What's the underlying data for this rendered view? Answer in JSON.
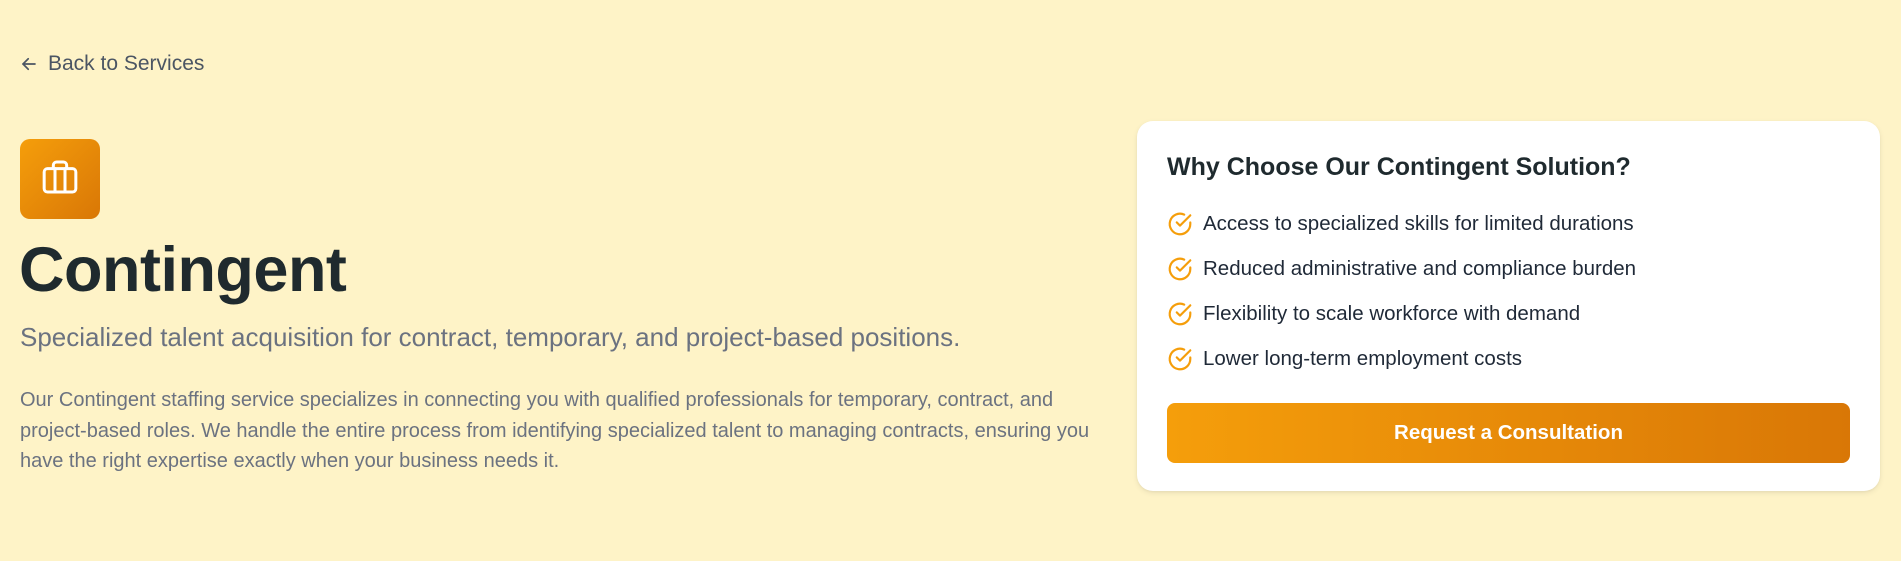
{
  "nav": {
    "back_label": "Back to Services",
    "back_icon": "arrow-left-icon"
  },
  "service": {
    "icon": "briefcase-icon",
    "icon_gradient": [
      "#f59e0b",
      "#d97706"
    ],
    "title": "Contingent",
    "subtitle": "Specialized talent acquisition for contract, temporary, and project-based positions.",
    "description": "Our Contingent staffing service specializes in connecting you with qualified professionals for temporary, contract, and project-based roles. We handle the entire process from identifying specialized talent to managing contracts, ensuring you have the right expertise exactly when your business needs it."
  },
  "card": {
    "title": "Why Choose Our Contingent Solution?",
    "benefit_icon": "check-circle-icon",
    "benefits": [
      "Access to specialized skills for limited durations",
      "Reduced administrative and compliance burden",
      "Flexibility to scale workforce with demand",
      "Lower long-term employment costs"
    ],
    "cta_label": "Request a Consultation"
  },
  "colors": {
    "page_background": "#fef3c7",
    "accent": "#f59e0b",
    "accent_dark": "#d97706",
    "heading": "#1f2a2e",
    "muted_text": "#6b7280"
  }
}
